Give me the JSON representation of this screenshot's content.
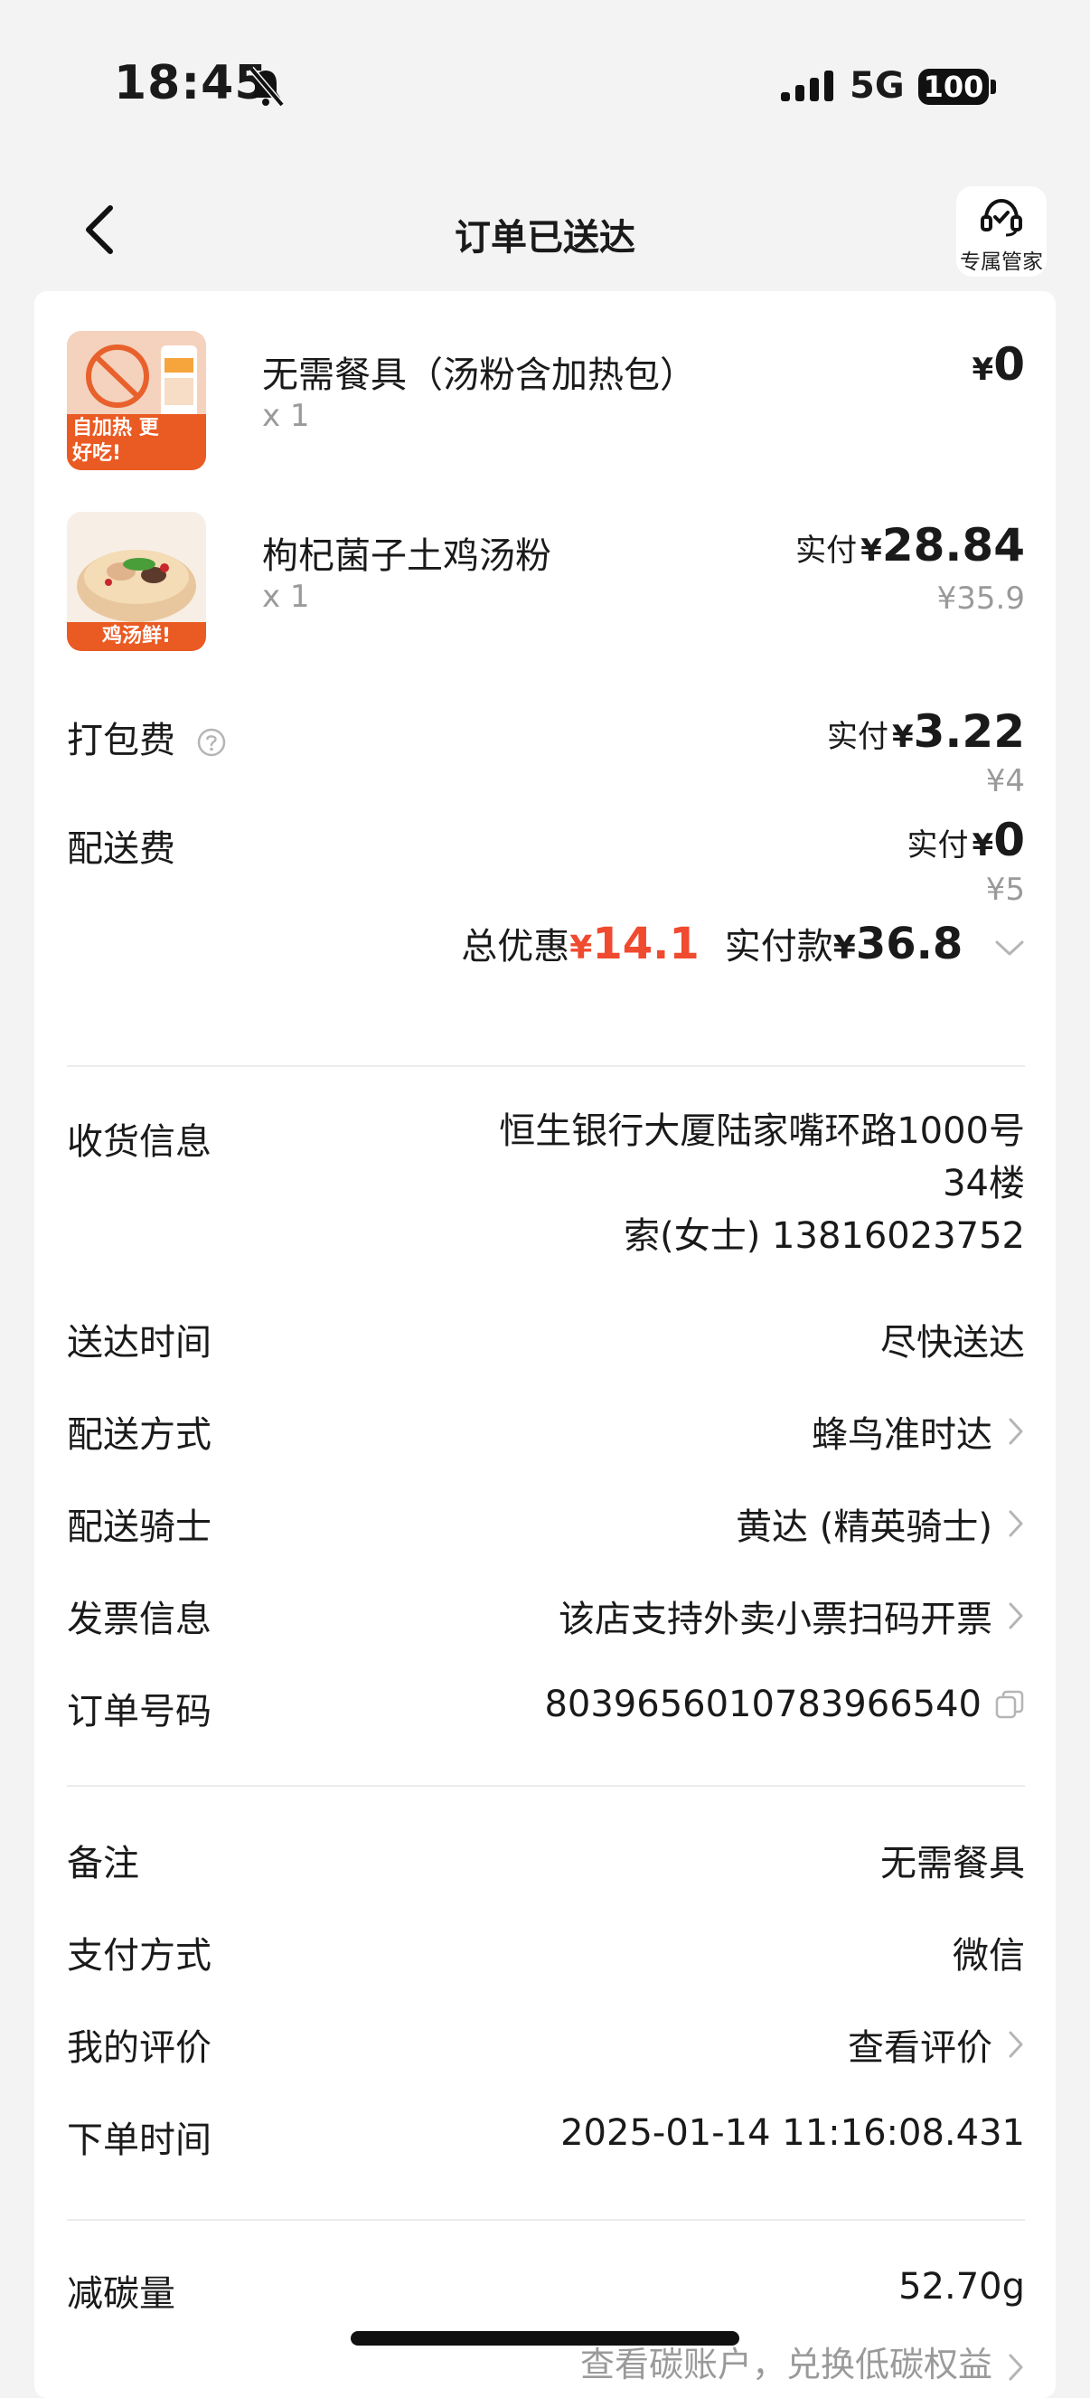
{
  "status_bar": {
    "time": "18:45",
    "network": "5G",
    "battery": "100"
  },
  "header": {
    "title": "订单已送达",
    "service_label": "专属管家"
  },
  "products": [
    {
      "name": "无需餐具（汤粉含加热包）",
      "qty": "x 1",
      "yen": "¥",
      "price": "0",
      "thumb_caption": "自加热 更好吃!"
    },
    {
      "name": "枸杞菌子土鸡汤粉",
      "qty": "x 1",
      "paid_label": "实付",
      "yen": "¥",
      "price": "28.84",
      "original_price": "¥35.9",
      "thumb_caption": "鸡汤鲜!"
    }
  ],
  "fees": [
    {
      "label": "打包费",
      "paid_label": "实付",
      "yen": "¥",
      "price": "3.22",
      "original_price": "¥4"
    },
    {
      "label": "配送费",
      "paid_label": "实付",
      "yen": "¥",
      "price": "0",
      "original_price": "¥5"
    }
  ],
  "totals": {
    "discount_label": "总优惠",
    "discount_yen": "¥",
    "discount_amount": "14.1",
    "paid_label": "实付款",
    "paid_yen": "¥",
    "paid_amount": "36.8"
  },
  "delivery": {
    "address_label": "收货信息",
    "address_line1": "恒生银行大厦陆家嘴环路1000号",
    "address_line2": "34楼",
    "address_line3": "索(女士) 13816023752",
    "time_label": "送达时间",
    "time_value": "尽快送达",
    "method_label": "配送方式",
    "method_value": "蜂鸟准时达",
    "rider_label": "配送骑士",
    "rider_value": "黄达 (精英骑士)",
    "invoice_label": "发票信息",
    "invoice_value": "该店支持外卖小票扫码开票",
    "order_no_label": "订单号码",
    "order_no_value": "8039656010783966540"
  },
  "order_info": {
    "note_label": "备注",
    "note_value": "无需餐具",
    "payment_label": "支付方式",
    "payment_value": "微信",
    "review_label": "我的评价",
    "review_value": "查看评价",
    "order_time_label": "下单时间",
    "order_time_value": "2025-01-14 11:16:08.431"
  },
  "carbon": {
    "label": "减碳量",
    "value": "52.70g",
    "link": "查看碳账户，兑换低碳权益"
  },
  "colors": {
    "accent_red": "#f04a2f",
    "muted_gray": "#9a9a9a",
    "page_bg": "#f3f3f3"
  }
}
